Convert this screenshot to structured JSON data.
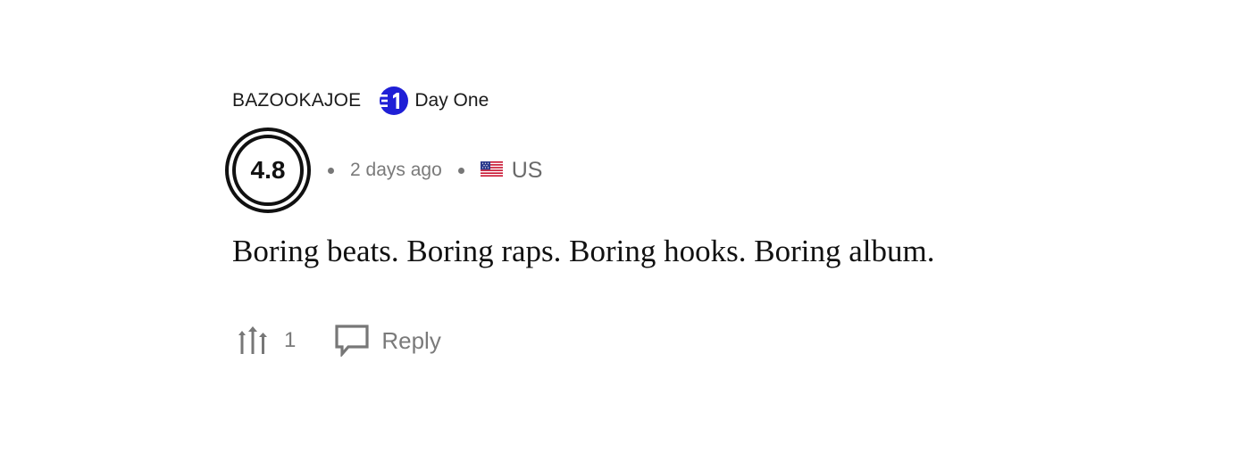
{
  "review": {
    "username": "BAZOOKAJOE",
    "badge": {
      "icon": "day-one-badge-icon",
      "label": "Day One",
      "color": "#1f1fd6"
    },
    "score": "4.8",
    "time_ago": "2 days ago",
    "country": {
      "flag_icon": "us-flag-icon",
      "label": "US"
    },
    "text": "Boring beats. Boring raps. Boring hooks. Boring album.",
    "upvote": {
      "icon": "upvote-arrows-icon",
      "count": "1"
    },
    "reply": {
      "icon": "speech-bubble-icon",
      "label": "Reply"
    }
  }
}
